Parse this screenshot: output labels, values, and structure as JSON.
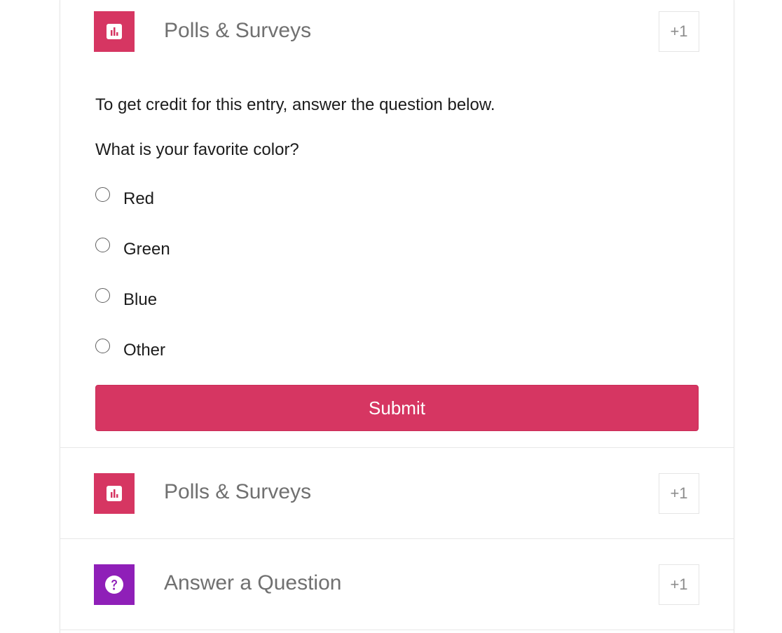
{
  "colors": {
    "polls_icon_bg": "#d63662",
    "question_icon_bg": "#8f1fb8",
    "submit_bg": "#d63662"
  },
  "entries": [
    {
      "title": "Polls & Surveys",
      "points": "+1",
      "icon": "bar-chart-icon",
      "expanded": true,
      "intro": "To get credit for this entry, answer the question below.",
      "question": "What is your favorite color?",
      "options": [
        "Red",
        "Green",
        "Blue",
        "Other"
      ],
      "selected_option": null,
      "submit_label": "Submit"
    },
    {
      "title": "Polls & Surveys",
      "points": "+1",
      "icon": "bar-chart-icon",
      "expanded": false
    },
    {
      "title": "Answer a Question",
      "points": "+1",
      "icon": "question-mark-icon",
      "expanded": false
    }
  ]
}
